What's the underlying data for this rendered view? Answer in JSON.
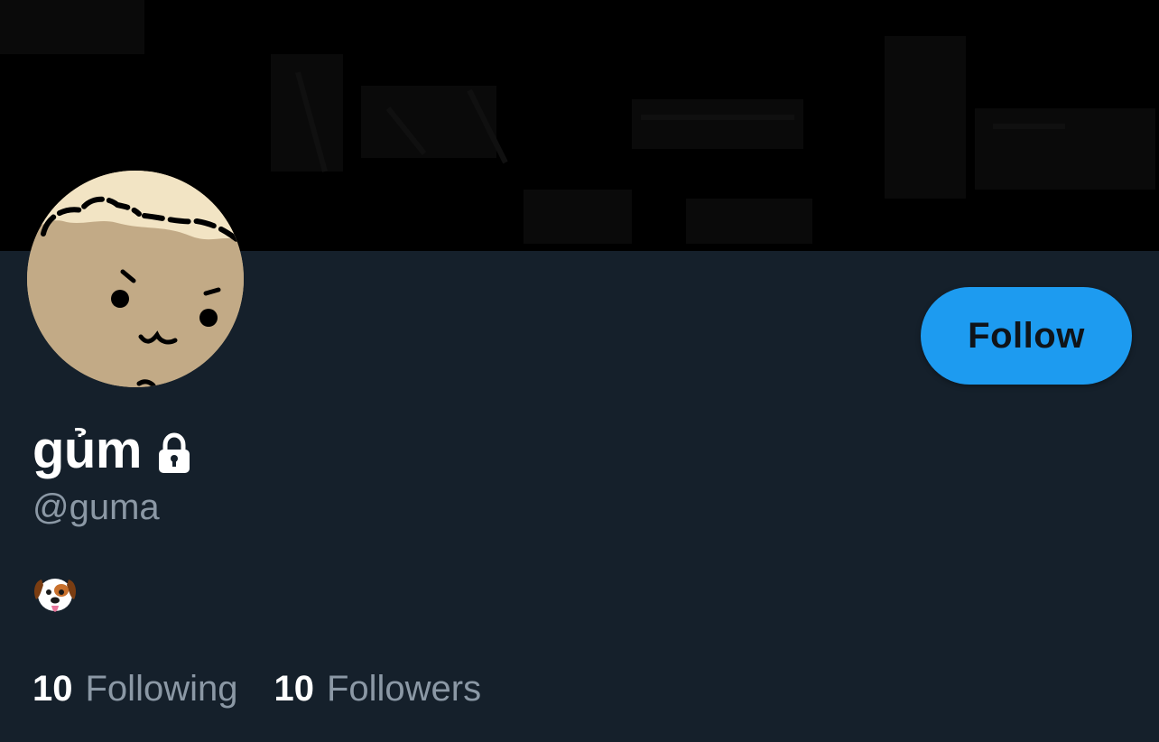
{
  "profile": {
    "display_name": "gủm",
    "handle": "@guma",
    "bio": "🐶",
    "protected_icon": "lock-icon",
    "bio_icon": "dog-face-emoji"
  },
  "actions": {
    "follow_label": "Follow"
  },
  "stats": {
    "following_count": "10",
    "following_label": "Following",
    "followers_count": "10",
    "followers_label": "Followers"
  },
  "colors": {
    "background": "#15202b",
    "banner": "#000000",
    "accent": "#1d9bf0",
    "secondary_text": "#8b98a5",
    "primary_text": "#ffffff"
  }
}
